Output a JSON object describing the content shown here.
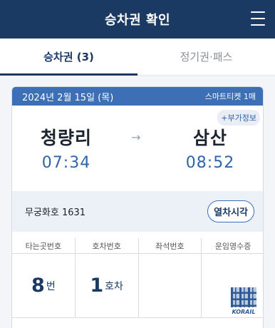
{
  "header": {
    "title": "승차권 확인",
    "menu_icon": "hamburger-menu-icon"
  },
  "tabs": [
    {
      "label": "승차권 (3)",
      "active": true
    },
    {
      "label": "정기권·패스",
      "active": false
    }
  ],
  "ticket": {
    "date": "2024년 2월 15일 (목)",
    "ticket_type": "스마트티켓 1매",
    "addon_label": "+부가정보",
    "departure": {
      "station": "청량리",
      "time": "07:34"
    },
    "arrival": {
      "station": "삼산",
      "time": "08:52"
    },
    "arrow_icon": "arrow-right-icon",
    "train_name": "무궁화호 1631",
    "train_times_button": "열차시각",
    "columns": [
      "타는곳번호",
      "호차번호",
      "좌석번호",
      "운임영수증"
    ],
    "platform": {
      "value": "8",
      "unit": "번"
    },
    "car": {
      "value": "1",
      "unit": "호차"
    },
    "seat": "",
    "receipt_brand": "KORAIL"
  },
  "colors": {
    "header_bg": "#1b3a63",
    "ticket_head_bg": "#3c6fb5",
    "accent": "#3064a8"
  }
}
